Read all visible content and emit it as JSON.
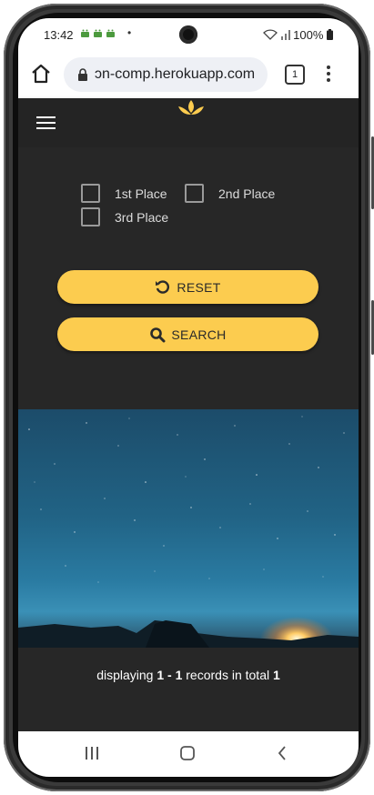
{
  "status_bar": {
    "time": "13:42",
    "notification_icons": "android-icons",
    "dot": "•",
    "battery": "100%"
  },
  "browser": {
    "url": "ɔn-comp.herokuapp.com",
    "tab_count": "1"
  },
  "filters": {
    "checkboxes": [
      {
        "label": "1st Place",
        "checked": false
      },
      {
        "label": "2nd Place",
        "checked": false
      },
      {
        "label": "3rd Place",
        "checked": false
      }
    ]
  },
  "buttons": {
    "reset_label": "RESET",
    "search_label": "SEARCH"
  },
  "results": {
    "prefix": "displaying ",
    "range": "1 - 1",
    "middle": " records in total ",
    "total": "1"
  },
  "colors": {
    "accent": "#fccc4f",
    "background": "#272727",
    "header": "#242424"
  },
  "icons": {
    "home": "home-icon",
    "lock": "lock-icon",
    "menu": "more-vert-icon",
    "hamburger": "hamburger-menu-icon",
    "logo": "lotus-logo-icon",
    "reset": "undo-icon",
    "search": "search-icon"
  }
}
